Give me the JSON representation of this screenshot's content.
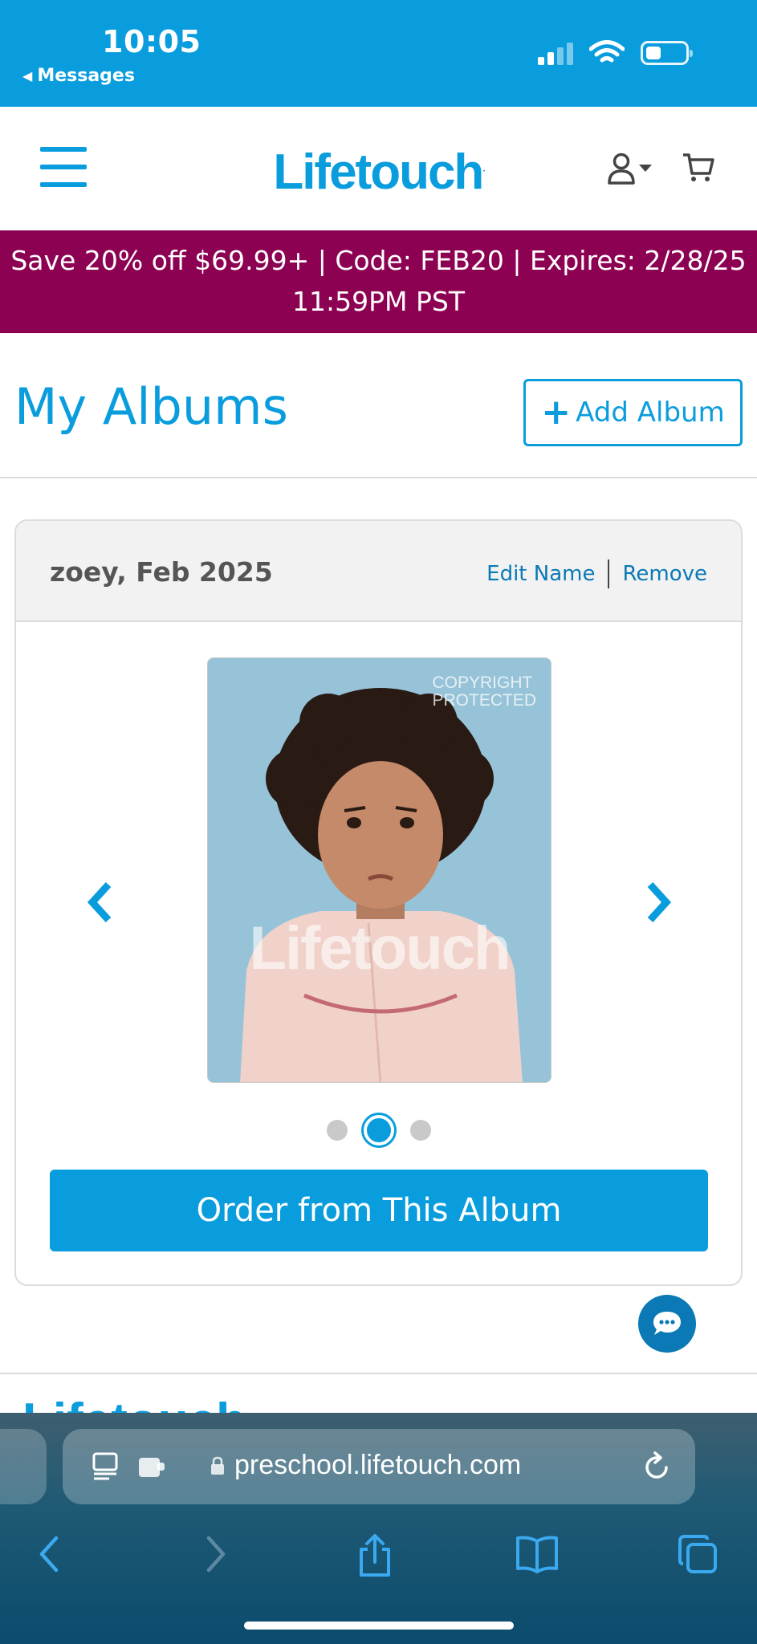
{
  "status_bar": {
    "time": "10:05",
    "back_label": "Messages",
    "back_arrow": "◀"
  },
  "header": {
    "logo": "Lifetouch",
    "logo_mark": "."
  },
  "promo": {
    "text": "Save 20% off $69.99+ | Code: FEB20 | Expires: 2/28/25 11:59PM PST"
  },
  "albums": {
    "title": "My Albums",
    "add_plus": "+",
    "add_label": "Add Album"
  },
  "album_card": {
    "name": "zoey, Feb 2025",
    "edit_label": "Edit Name",
    "remove_label": "Remove",
    "photo": {
      "copyright_line1": "COPYRIGHT",
      "copyright_line2": "PROTECTED",
      "watermark": "Lifetouch"
    },
    "carousel": {
      "total": 3,
      "active_index": 1
    },
    "order_label": "Order from This Album"
  },
  "footer": {
    "peek_text": "Lifetouch"
  },
  "safari": {
    "url": "preschool.lifetouch.com"
  },
  "colors": {
    "brand_blue": "#0a9ddd",
    "promo_bg": "#8c0152",
    "link_blue": "#0a79b5"
  }
}
